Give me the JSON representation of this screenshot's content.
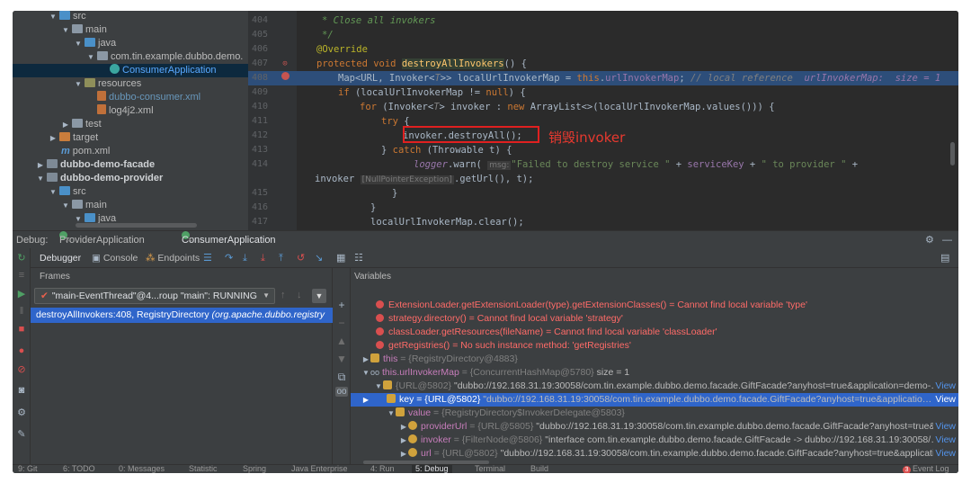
{
  "project_tree": {
    "items": [
      {
        "label": "src",
        "kind": "f-src",
        "tri": "▼"
      },
      {
        "label": "main",
        "kind": "f-plain",
        "tri": "▼"
      },
      {
        "label": "java",
        "kind": "f-src",
        "tri": "▼"
      },
      {
        "label": "com.tin.example.dubbo.demo.",
        "kind": "f-plain",
        "tri": "▼"
      },
      {
        "label": "ConsumerApplication",
        "kind": "f-cls",
        "tri": "",
        "style": "t-sel"
      },
      {
        "label": "resources",
        "kind": "f-res",
        "tri": "▼"
      },
      {
        "label": "dubbo-consumer.xml",
        "kind": "f-xml",
        "tri": "",
        "style": "t-blue"
      },
      {
        "label": "log4j2.xml",
        "kind": "f-xml",
        "tri": ""
      },
      {
        "label": "test",
        "kind": "f-plain",
        "tri": "▶"
      },
      {
        "label": "target",
        "kind": "f-target",
        "tri": "▶"
      },
      {
        "label": "pom.xml",
        "kind": "f-m",
        "tri": ""
      },
      {
        "label": "dubbo-demo-facade",
        "kind": "f-mod",
        "tri": "▶",
        "style": "t-bold"
      },
      {
        "label": "dubbo-demo-provider",
        "kind": "f-mod",
        "tri": "▼",
        "style": "t-bold"
      },
      {
        "label": "src",
        "kind": "f-src",
        "tri": "▼"
      },
      {
        "label": "main",
        "kind": "f-plain",
        "tri": "▼"
      },
      {
        "label": "java",
        "kind": "f-src",
        "tri": "▼"
      }
    ]
  },
  "editor": {
    "line_numbers": [
      "404",
      "405",
      "406",
      "407",
      "408",
      "409",
      "410",
      "411",
      "412",
      "413",
      "414",
      "",
      "415",
      "416",
      "417"
    ],
    "annotation": "销毁invoker",
    "lines": {
      "l404": "* Close all invokers",
      "l405": "*/",
      "l406": "@Override",
      "l407_kw": "protected void ",
      "l407_fn": "destroyAllInvokers",
      "l407_rest": "() {",
      "l408_a": "Map<URL, Invoker<",
      "l408_t": "T",
      "l408_b": ">> localUrlInvokerMap = ",
      "l408_kw": "this",
      "l408_c": ".",
      "l408_fld": "urlInvokerMap",
      "l408_d": "; ",
      "l408_cmt": "// local reference",
      "l408_hint": "urlInvokerMap:  size = 1",
      "l409_kw": "if ",
      "l409_a": "(localUrlInvokerMap != ",
      "l409_kw2": "null",
      "l409_b": ") {",
      "l410_kw": "for ",
      "l410_a": "(Invoker<",
      "l410_t": "T",
      "l410_b": "> invoker : ",
      "l410_kw2": "new ",
      "l410_c": "ArrayList<>(localUrlInvokerMap.values())) {",
      "l411_kw": "try ",
      "l411_a": "{",
      "l412": "invoker.destroyAll();",
      "l413_a": "} ",
      "l413_kw": "catch ",
      "l413_b": "(Throwable t) {",
      "l414_fld": "logger",
      "l414_a": ".warn( ",
      "l414_hint": "msg:",
      "l414_str": "\"Failed to destroy service \"",
      "l414_b": " + ",
      "l414_fld2": "serviceKey",
      "l414_c": " + ",
      "l414_str2": "\" to provider \"",
      "l414_d": " +",
      "l414w_a": "invoker",
      "l414w_hint": "[NullPointerException]",
      "l414w_b": ".getUrl(), t);",
      "l415": "}",
      "l416": "}",
      "l417": "localUrlInvokerMap.clear();"
    }
  },
  "debug": {
    "label": "Debug:",
    "sessions": [
      "ProviderApplication",
      "ConsumerApplication"
    ],
    "tabs": {
      "debugger": "Debugger",
      "console": "Console",
      "endpoints": "Endpoints"
    },
    "frames_title": "Frames",
    "thread": "\"main-EventThread\"@4...roup \"main\": RUNNING",
    "frame_method": "destroyAllInvokers:408, RegistryDirectory ",
    "frame_class": "(org.apache.dubbo.registry",
    "variables_title": "Variables",
    "errors": [
      {
        "expr": "ExtensionLoader.getExtensionLoader(type).getExtensionClasses() = Cannot find local variable 'type'"
      },
      {
        "expr": "strategy.directory() = Cannot find local variable 'strategy'"
      },
      {
        "expr": "classLoader.getResources(fileName) = Cannot find local variable 'classLoader'"
      },
      {
        "expr": "getRegistries() = No such instance method: 'getRegistries'"
      }
    ],
    "vars": {
      "this_name": "this",
      "this_val": " = {RegistryDirectory@4883}",
      "map_name": "this.urlInvokerMap",
      "map_val": " = {ConcurrentHashMap@5780} ",
      "map_size": " size = 1",
      "entry_val": "{URL@5802} ",
      "entry_str": "\"dubbo://192.168.31.19:30058/com.tin.example.dubbo.demo.facade.GiftFacade?anyhost=true&application=demo-…",
      "key_name": "key",
      "key_val": " = {URL@5802} ",
      "key_str": "\"dubbo://192.168.31.19:30058/com.tin.example.dubbo.demo.facade.GiftFacade?anyhost=true&applicatio…",
      "value_name": "value",
      "value_val": " = {RegistryDirectory$InvokerDelegate@5803}",
      "provider_name": "providerUrl",
      "provider_val": " = {URL@5805} ",
      "provider_str": "\"dubbo://192.168.31.19:30058/com.tin.example.dubbo.demo.facade.GiftFacade?anyhost=true&…",
      "invoker_name": "invoker",
      "invoker_val": " = {FilterNode@5806} ",
      "invoker_str": "\"interface com.tin.example.dubbo.demo.facade.GiftFacade -> dubbo://192.168.31.19:30058/…",
      "url_name": "url",
      "url_val": " = {URL@5802} ",
      "url_str": "\"dubbo://192.168.31.19:30058/com.tin.example.dubbo.demo.facade.GiftFacade?anyhost=true&applicati…",
      "view": "View"
    }
  },
  "status_bar": {
    "items": [
      "9: Git",
      "6: TODO",
      "0: Messages",
      "Statistic",
      "Spring",
      "Java Enterprise",
      "4: Run",
      "5: Debug",
      "Terminal",
      "Build"
    ],
    "event_log": "Event Log",
    "event_count": "3"
  }
}
